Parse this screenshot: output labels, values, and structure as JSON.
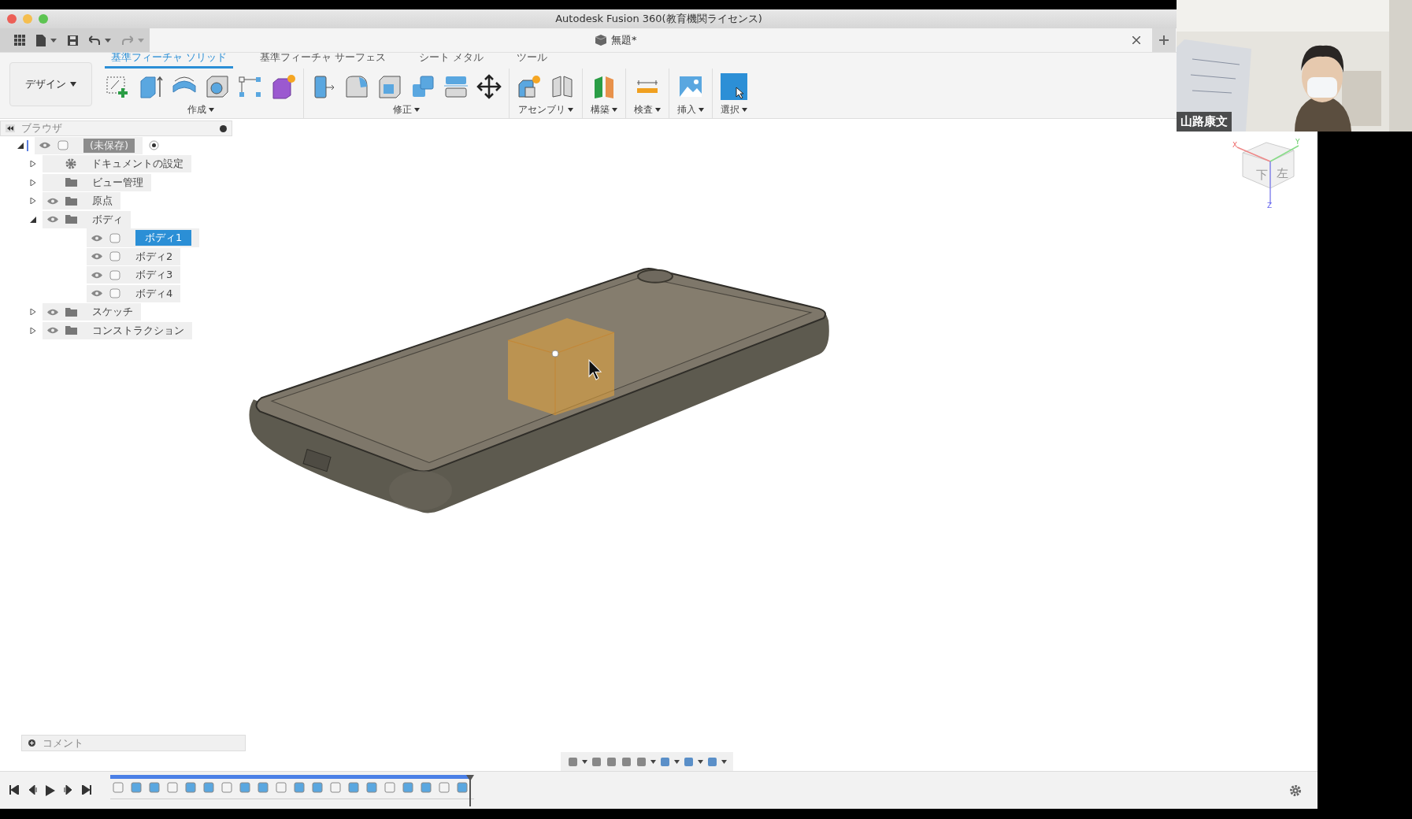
{
  "window": {
    "title": "Autodesk Fusion 360(教育機関ライセンス)"
  },
  "document_tab": {
    "title": "無題*"
  },
  "workspace": {
    "label": "デザイン"
  },
  "toolbar_tabs": [
    {
      "label": "基準フィーチャ ソリッド",
      "selected": true
    },
    {
      "label": "基準フィーチャ サーフェス",
      "selected": false
    },
    {
      "label": "シート メタル",
      "selected": false
    },
    {
      "label": "ツール",
      "selected": false
    }
  ],
  "tool_groups": [
    {
      "label": "作成"
    },
    {
      "label": "修正"
    },
    {
      "label": "アセンブリ"
    },
    {
      "label": "構築"
    },
    {
      "label": "検査"
    },
    {
      "label": "挿入"
    },
    {
      "label": "選択"
    }
  ],
  "browser": {
    "title": "ブラウザ",
    "tree": [
      {
        "label": "(未保存)",
        "kind": "root",
        "visibility_toggle": true,
        "expanded": true,
        "selected": false,
        "children": [
          {
            "label": "ドキュメントの設定",
            "kind": "settings",
            "visibility_toggle": false,
            "expanded": false,
            "selected": false
          },
          {
            "label": "ビュー管理",
            "kind": "folder",
            "visibility_toggle": false,
            "expanded": false,
            "selected": false
          },
          {
            "label": "原点",
            "kind": "folder",
            "visibility_toggle": true,
            "expanded": false,
            "selected": false
          },
          {
            "label": "ボディ",
            "kind": "folder",
            "visibility_toggle": true,
            "expanded": true,
            "selected": false,
            "children": [
              {
                "label": "ボディ1",
                "kind": "body",
                "visibility_toggle": true,
                "selected": true
              },
              {
                "label": "ボディ2",
                "kind": "body",
                "visibility_toggle": true,
                "selected": false
              },
              {
                "label": "ボディ3",
                "kind": "body",
                "visibility_toggle": true,
                "selected": false
              },
              {
                "label": "ボディ4",
                "kind": "body",
                "visibility_toggle": true,
                "selected": false
              }
            ]
          },
          {
            "label": "スケッチ",
            "kind": "folder",
            "visibility_toggle": true,
            "expanded": false,
            "selected": false
          },
          {
            "label": "コンストラクション",
            "kind": "folder",
            "visibility_toggle": true,
            "expanded": false,
            "selected": false
          }
        ]
      }
    ]
  },
  "view_cube": {
    "faces": [
      "下",
      "左"
    ],
    "axes": [
      "X",
      "Y",
      "Z"
    ]
  },
  "comments": {
    "label": "コメント"
  },
  "video_overlay": {
    "kind": "picture",
    "name": "山路康文"
  }
}
